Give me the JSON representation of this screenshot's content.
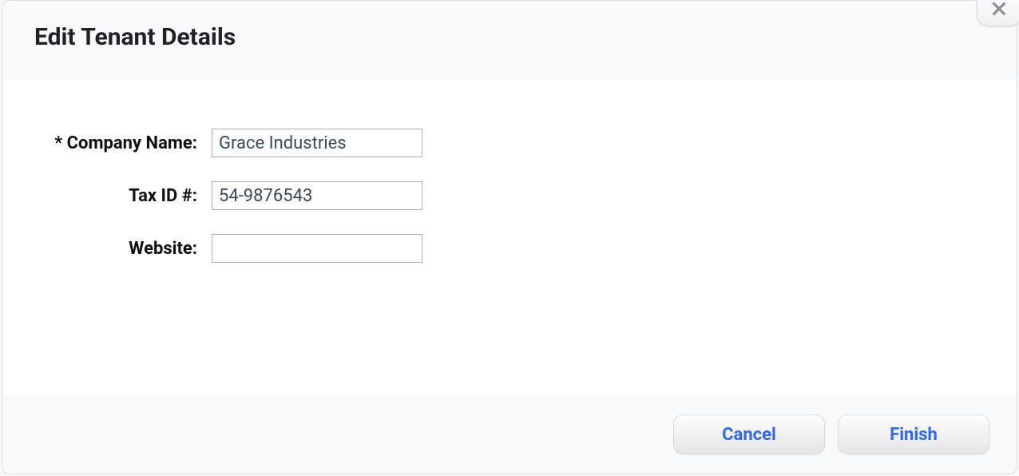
{
  "dialog": {
    "title": "Edit Tenant Details"
  },
  "form": {
    "companyName": {
      "label": "* Company Name:",
      "value": "Grace Industries"
    },
    "taxId": {
      "label": "Tax ID #:",
      "value": "54-9876543"
    },
    "website": {
      "label": "Website:",
      "value": ""
    }
  },
  "actions": {
    "cancel": "Cancel",
    "finish": "Finish"
  }
}
